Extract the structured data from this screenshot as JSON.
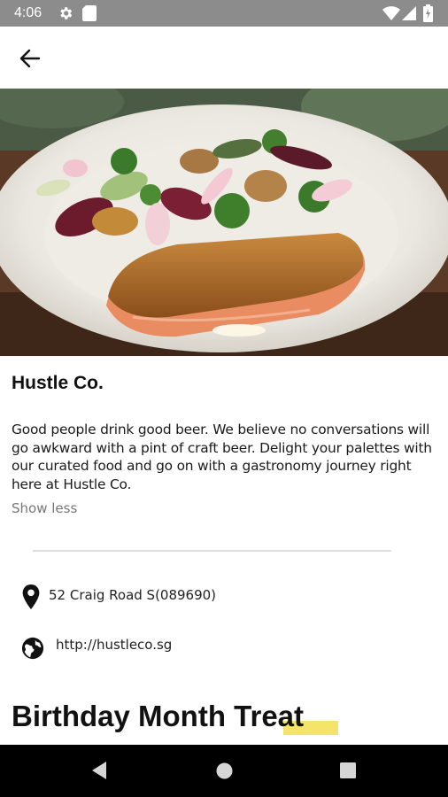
{
  "status_bar": {
    "time": "4:06",
    "icons": [
      "gear-icon",
      "sd-card-icon",
      "wifi-icon",
      "signal-icon",
      "battery-icon"
    ]
  },
  "app_bar": {
    "back_icon": "arrow-back-icon"
  },
  "venue": {
    "name": "Hustle Co.",
    "description": "Good people drink good beer. We believe no conversations will go awkward with a pint of craft beer. Delight your palettes with our curated food and go on with a gastronomy journey right here at Hustle Co.",
    "toggle_label": "Show less",
    "address": "52 Craig Road S(089690)",
    "website": "http://hustleco.sg"
  },
  "section": {
    "title": "Birthday Month Treat"
  },
  "nav_bar": {
    "icons": [
      "back-triangle-icon",
      "home-circle-icon",
      "recents-square-icon"
    ]
  },
  "colors": {
    "status_bar_bg": "#8c8c8c",
    "nav_bar_bg": "#000000",
    "highlight": "#f4e56a",
    "secondary_text": "#777777"
  }
}
